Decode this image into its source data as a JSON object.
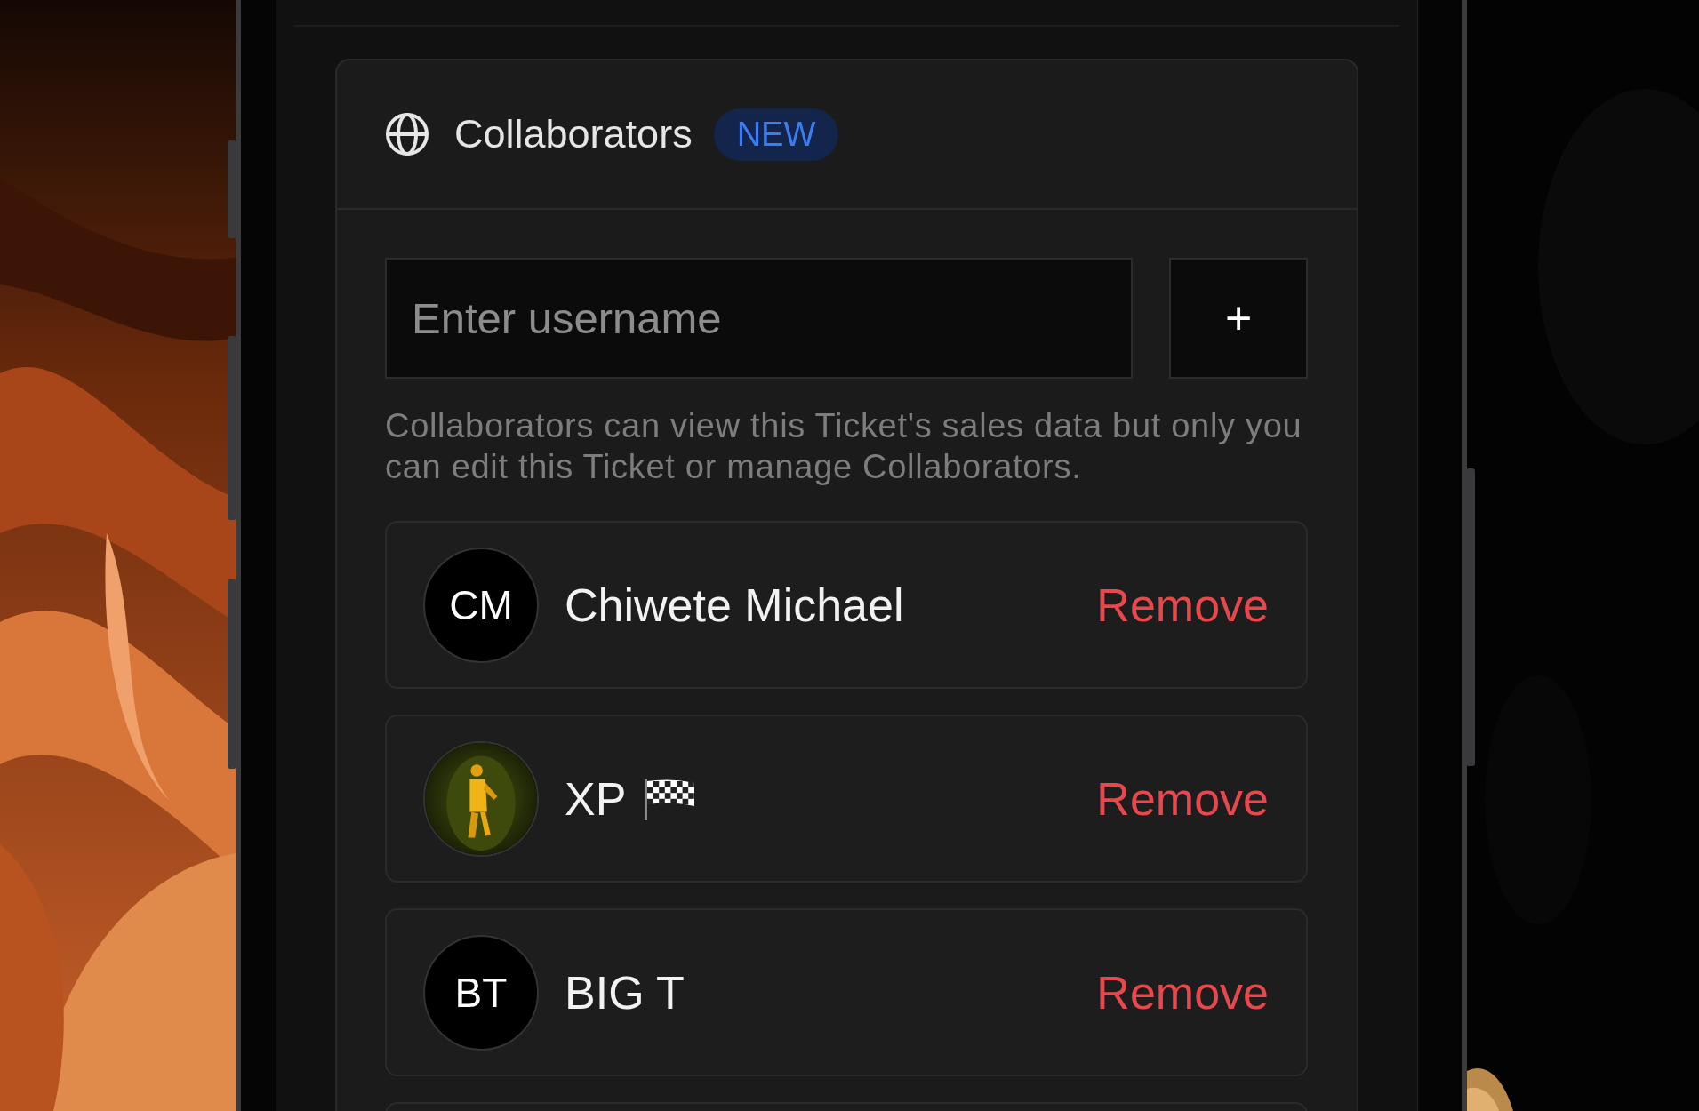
{
  "card": {
    "title": "Collaborators",
    "badge": "NEW"
  },
  "username_field": {
    "placeholder": "Enter username"
  },
  "add_button": "+",
  "help_text": "Collaborators can view this Ticket's sales data but only you can edit this Ticket or manage Collaborators.",
  "collaborators": [
    {
      "name": "Chiwete Michael",
      "initials": "CM",
      "kind": "initials",
      "flag_icon": false,
      "action": "Remove"
    },
    {
      "name": "XP",
      "kind": "picture",
      "flag_icon": true,
      "action": "Remove"
    },
    {
      "name": "BIG T",
      "initials": "BT",
      "kind": "initials",
      "flag_icon": false,
      "action": "Remove"
    }
  ]
}
